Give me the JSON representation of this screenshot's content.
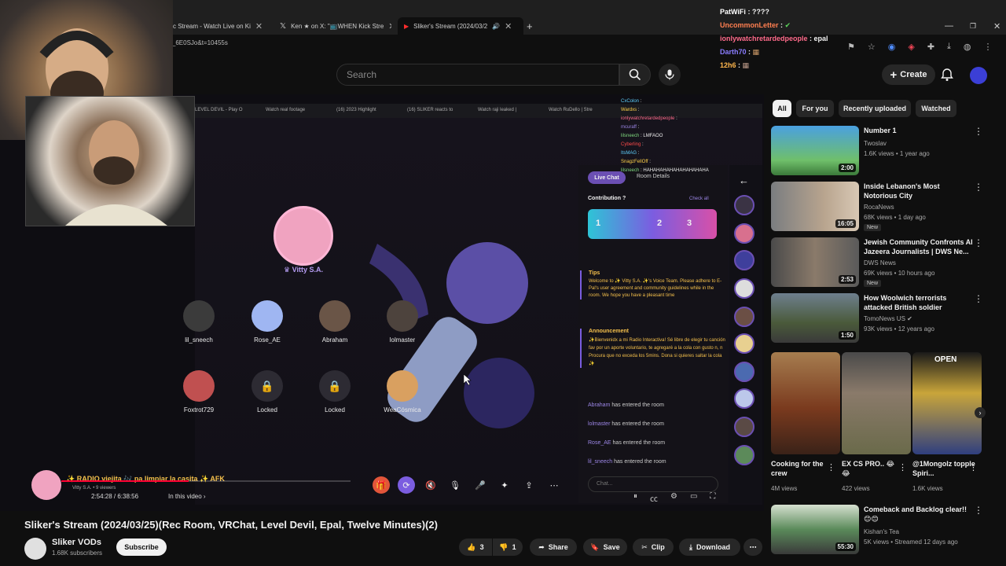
{
  "browser": {
    "tabs": [
      {
        "label": "c Stream - Watch Live on Ki"
      },
      {
        "label": "Ken ★ on X: \"📺WHEN Kick Stre"
      },
      {
        "label": "Sliker's Stream (2024/03/2"
      }
    ],
    "url": "ng_6E0SJo&t=10455s"
  },
  "header": {
    "search_placeholder": "Search",
    "create_label": "Create"
  },
  "top_chat": [
    {
      "user": "PatWiFi",
      "text": ": ????",
      "color": "#ffffff"
    },
    {
      "user": "UncommonLetter",
      "text": ":",
      "color": "#ff7f50"
    },
    {
      "user": "ionlywatchretardedpeople",
      "text": ": epal",
      "color": "#ff6b8b"
    },
    {
      "user": "Darth70",
      "text": ":",
      "color": "#8a7dff"
    },
    {
      "user": "12h6",
      "text": ":",
      "color": "#ffb74d"
    }
  ],
  "stream": {
    "inner_tabs": [
      "LEVEL DEVIL - Play O",
      "Watch real footage",
      "(16) 2023 Highlight",
      "(16) SLIKER reacts to",
      "Watch raji leaked |",
      "Watch RuDello | Stre"
    ],
    "overlay_chat": [
      {
        "user": "CxColon",
        "text": ":"
      },
      {
        "user": "Wardxs",
        "text": ":"
      },
      {
        "user": "ionlywatchretardedpeople",
        "text": ":"
      },
      {
        "user": "mcuraff",
        "text": ":"
      },
      {
        "user": "lilsneech",
        "text": ": LMFAOO"
      },
      {
        "user": "Cyberling",
        "text": ":"
      },
      {
        "user": "ItsMAG",
        "text": ":"
      },
      {
        "user": "SnagzFellOff",
        "text": ":"
      },
      {
        "user": "lilsneech",
        "text": ": HAHAHAHAHAHAHAHAHAHA"
      }
    ],
    "host_name": "Vitty S.A.",
    "seats": [
      {
        "name": "lil_sneech",
        "locked": false
      },
      {
        "name": "Rose_AE",
        "locked": false
      },
      {
        "name": "Abraham",
        "locked": false
      },
      {
        "name": "lolmaster",
        "locked": false
      },
      {
        "name": "Foxtrot729",
        "locked": false
      },
      {
        "name": "Locked",
        "locked": true
      },
      {
        "name": "Locked",
        "locked": true
      },
      {
        "name": "WeaCósmica",
        "locked": false
      }
    ],
    "panel": {
      "tab_live": "Live Chat",
      "tab_room": "Room Details",
      "contribution_label": "Contribution",
      "check_all": "Check all",
      "ranks": [
        "1",
        "2",
        "3"
      ],
      "tips_title": "Tips",
      "tips_text": "Welcome to ✨ Vitty S.A. ✨'s Voice Team. Please adhere to E-Pal's user agreement and community guidelines while in the room. We hope you have a pleasant time",
      "announcement_title": "Announcement",
      "announcement_text": "✨Bienvenidx a mi Radio Interactiva! Sé libre de elegir tu canción fav por un aporte voluntario, te agregaré a la cola con gusto n, n Procura que no exceda los 5mins. Dona si quieres saltar la cola ✨",
      "events": [
        {
          "user": "Abraham",
          "text": "has entered the room"
        },
        {
          "user": "lolmaster",
          "text": "has entered the room"
        },
        {
          "user": "Rose_AE",
          "text": "has entered the room"
        },
        {
          "user": "lil_sneech",
          "text": "has entered the room"
        }
      ],
      "chat_placeholder": "Chat..."
    },
    "room_title": "✨ RADIO viejita 🎶 pa limpiar la casita ✨ AFK",
    "room_host": "Vitty S.A.",
    "room_viewers": "9 viewers",
    "time": "2:54:28 / 6:38:56",
    "in_video": "In this video",
    "progress": 0.44
  },
  "video": {
    "title": "Sliker's Stream (2024/03/25)(Rec Room, VRChat, Level Devil, Epal, Twelve Minutes)(2)",
    "channel": "Sliker VODs",
    "subs": "1.68K subscribers",
    "subscribe": "Subscribe",
    "likes": "3",
    "dislikes": "1",
    "share": "Share",
    "save": "Save",
    "clip": "Clip",
    "download": "Download"
  },
  "sidebar": {
    "chips": [
      "All",
      "For you",
      "Recently uploaded",
      "Watched"
    ],
    "recs": [
      {
        "title": "Number 1",
        "channel": "Twoslav",
        "meta": "1.6K views • 1 year ago",
        "duration": "2:00",
        "new": ""
      },
      {
        "title": "Inside Lebanon's Most Notorious City",
        "channel": "RocaNews",
        "meta": "68K views • 1 day ago",
        "duration": "16:05",
        "new": "New"
      },
      {
        "title": "Jewish Community Confronts Al Jazeera Journalists | DWS Ne...",
        "channel": "DWS News",
        "meta": "69K views • 10 hours ago",
        "duration": "2:53",
        "new": "New"
      },
      {
        "title": "How Woolwich terrorists attacked British soldier",
        "channel": "TomoNews US",
        "meta": "93K views • 12 years ago",
        "duration": "1:50",
        "new": ""
      }
    ],
    "shorts": [
      {
        "title": "Cooking for the crew",
        "views": "4M views"
      },
      {
        "title": "EX CS PRO.. 😂 😂",
        "views": "422 views"
      },
      {
        "title": "@1Mongolz topple Spiri...",
        "views": "1.6K views"
      }
    ],
    "last_rec": {
      "title": "Comeback and Backlog clear!! 😊😊",
      "channel": "Kishan's Tea",
      "meta": "5K views • Streamed 12 days ago",
      "duration": "55:30"
    }
  }
}
